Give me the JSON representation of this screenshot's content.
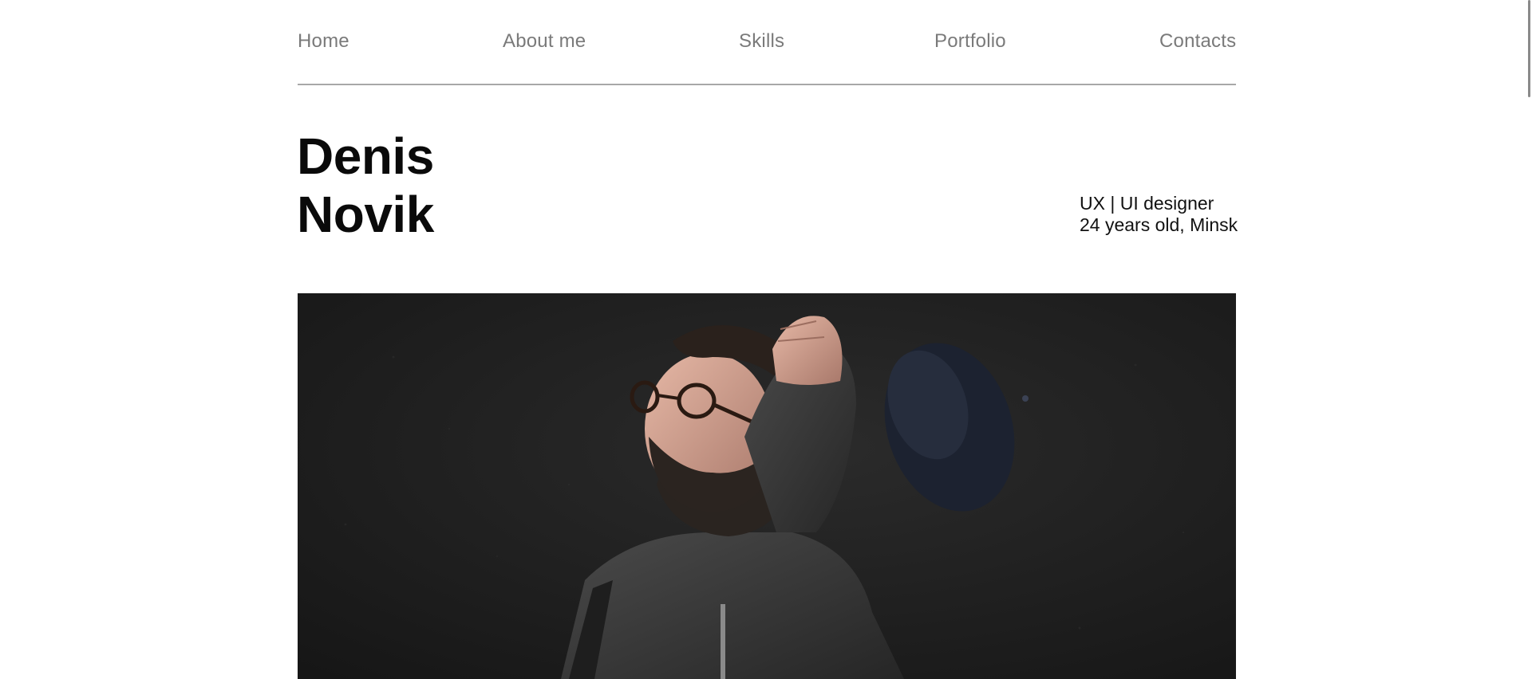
{
  "nav": {
    "items": [
      {
        "label": "Home"
      },
      {
        "label": "About me"
      },
      {
        "label": "Skills"
      },
      {
        "label": "Portfolio"
      },
      {
        "label": "Contacts"
      }
    ]
  },
  "hero": {
    "first_name": "Denis",
    "last_name": "Novik",
    "role": "UX | UI designer",
    "details": "24 years old, Minsk"
  },
  "photo": {
    "subject": "portrait-photo"
  },
  "colors": {
    "nav_text": "#7a7a7a",
    "heading": "#0a0a0a",
    "divider": "#a8a8a8",
    "photo_bg": "#1d1d1d"
  }
}
